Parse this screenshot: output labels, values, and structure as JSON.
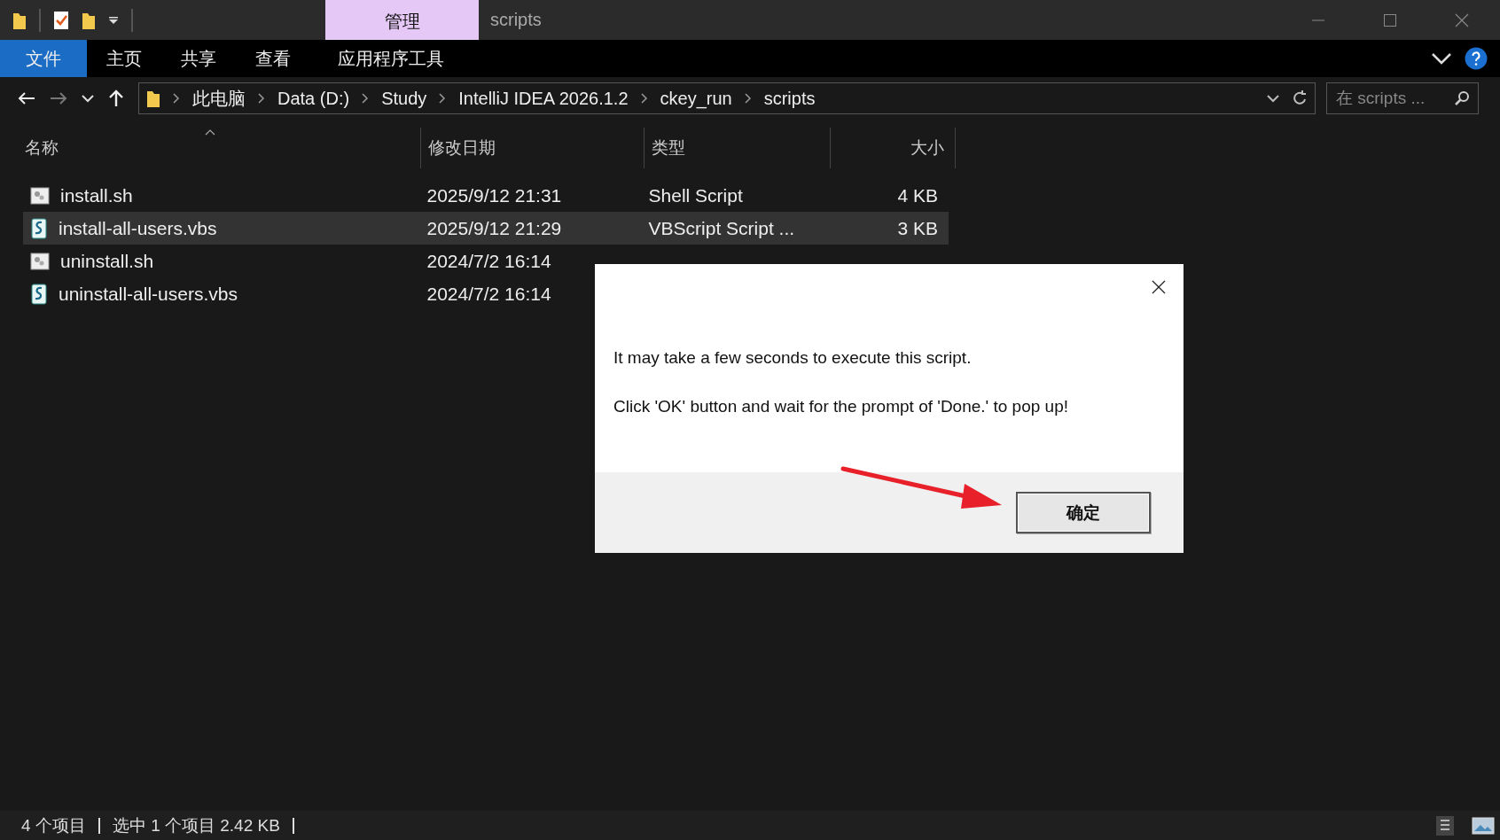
{
  "window": {
    "title": "scripts"
  },
  "ribbon": {
    "context_tab": "管理",
    "tabs": [
      {
        "label": "文件",
        "kind": "normal",
        "selected": true
      },
      {
        "label": "主页",
        "kind": "normal",
        "selected": false
      },
      {
        "label": "共享",
        "kind": "normal",
        "selected": false
      },
      {
        "label": "查看",
        "kind": "normal",
        "selected": false
      },
      {
        "label": "应用程序工具",
        "kind": "context",
        "selected": false
      }
    ]
  },
  "navigation": {
    "back": {
      "disabled": false
    },
    "forward": {
      "disabled": true
    }
  },
  "address": {
    "path": [
      "此电脑",
      "Data (D:)",
      "Study",
      "IntelliJ IDEA 2026.1.2",
      "ckey_run",
      "scripts"
    ]
  },
  "search": {
    "placeholder": "在 scripts ..."
  },
  "columns": [
    {
      "label": "名称",
      "sort_indicator": true
    },
    {
      "label": "修改日期",
      "sort_indicator": false
    },
    {
      "label": "类型",
      "sort_indicator": false
    },
    {
      "label": "大小",
      "sort_indicator": false
    }
  ],
  "files": [
    {
      "name": "install.sh",
      "modified": "2025/9/12 21:31",
      "type": "Shell Script",
      "size": "4 KB",
      "kind": "sh",
      "selected": false
    },
    {
      "name": "install-all-users.vbs",
      "modified": "2025/9/12 21:29",
      "type": "VBScript Script ...",
      "size": "3 KB",
      "kind": "vbs",
      "selected": true
    },
    {
      "name": "uninstall.sh",
      "modified": "2024/7/2 16:14",
      "kind": "sh",
      "selected": false
    },
    {
      "name": "uninstall-all-users.vbs",
      "modified": "2024/7/2 16:14",
      "kind": "vbs",
      "selected": false
    }
  ],
  "dialog": {
    "messages": [
      "It may take a few seconds to execute this script.",
      "Click 'OK' button and wait for the prompt of 'Done.' to pop up!"
    ],
    "button": "确定"
  },
  "status_bar": {
    "items": [
      "4 个项目",
      "选中 1 个项目  2.42 KB"
    ]
  }
}
